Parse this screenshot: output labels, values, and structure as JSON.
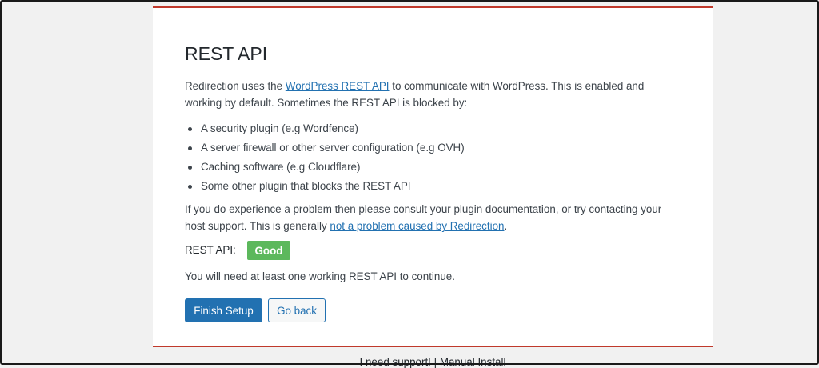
{
  "page": {
    "title": "REST API",
    "intro": {
      "before_link": "Redirection uses the ",
      "link": "WordPress REST API",
      "after_link": " to communicate with WordPress. This is enabled and working by default. Sometimes the REST API is blocked by:"
    },
    "reasons": [
      "A security plugin (e.g Wordfence)",
      "A server firewall or other server configuration (e.g OVH)",
      "Caching software (e.g Cloudflare)",
      "Some other plugin that blocks the REST API"
    ],
    "help": {
      "before_link": "If you do experience a problem then please consult your plugin documentation, or try contacting your host support. This is generally ",
      "link": "not a problem caused by Redirection",
      "after_link": "."
    },
    "status": {
      "label": "REST API:",
      "value": "Good",
      "color": "#5cb85c"
    },
    "note": "You will need at least one working REST API to continue.",
    "buttons": {
      "finish": "Finish Setup",
      "back": "Go back"
    }
  },
  "footer": {
    "support": "I need support!",
    "separator": " | ",
    "manual": "Manual Install"
  },
  "colors": {
    "accent": "#2271b1",
    "border_red": "#c0392b"
  }
}
